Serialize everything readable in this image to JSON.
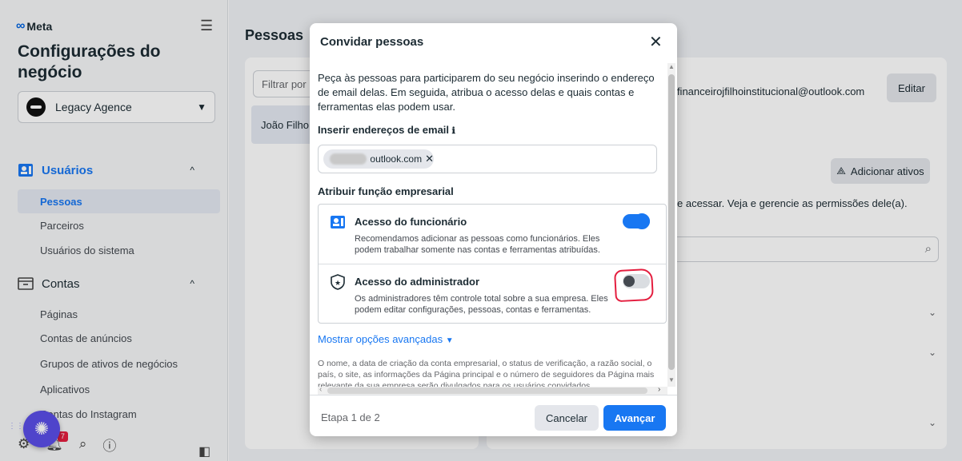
{
  "sidebar": {
    "logo": "Meta",
    "title": "Configurações do negócio",
    "business": "Legacy Agence",
    "sections": [
      {
        "label": "Usuários",
        "items": [
          "Pessoas",
          "Parceiros",
          "Usuários do sistema"
        ]
      },
      {
        "label": "Contas",
        "items": [
          "Páginas",
          "Contas de anúncios",
          "Grupos de ativos de negócios",
          "Aplicativos",
          "Contas do Instagram"
        ]
      }
    ],
    "notification_count": "7"
  },
  "main": {
    "page_title": "Pessoas",
    "filter_placeholder": "Filtrar por n",
    "person_name": "João Filho",
    "email_visible": "r financeirojfilhoinstitucional@outlook.com",
    "edit_label": "Editar",
    "add_assets_label": "Adicionar ativos",
    "access_text": "e acessar. Veja e gerencie as permissões dele(a)."
  },
  "modal": {
    "title": "Convidar pessoas",
    "intro": "Peça às pessoas para participarem do seu negócio inserindo o endereço de email delas. Em seguida, atribua o acesso delas e quais contas e ferramentas elas podem usar.",
    "email_label": "Inserir endereços de email",
    "email_chip": "outlook.com",
    "role_label": "Atribuir função empresarial",
    "roles": [
      {
        "title": "Acesso do funcionário",
        "desc": "Recomendamos adicionar as pessoas como funcionários. Eles podem trabalhar somente nas contas e ferramentas atribuídas.",
        "enabled": true
      },
      {
        "title": "Acesso do administrador",
        "desc": "Os administradores têm controle total sobre a sua empresa. Eles podem editar configurações, pessoas, contas e ferramentas.",
        "enabled": false
      }
    ],
    "advanced_link": "Mostrar opções avançadas",
    "disclaimer": "O nome, a data de criação da conta empresarial, o status de verificação, a razão social, o país, o site, as informações da Página principal e o número de seguidores da Página mais relevante da sua empresa serão divulgados para os usuários convidados",
    "step": "Etapa 1 de 2",
    "cancel_label": "Cancelar",
    "next_label": "Avançar"
  },
  "colors": {
    "accent": "#1877f2",
    "annotation": "#e41e3f"
  }
}
